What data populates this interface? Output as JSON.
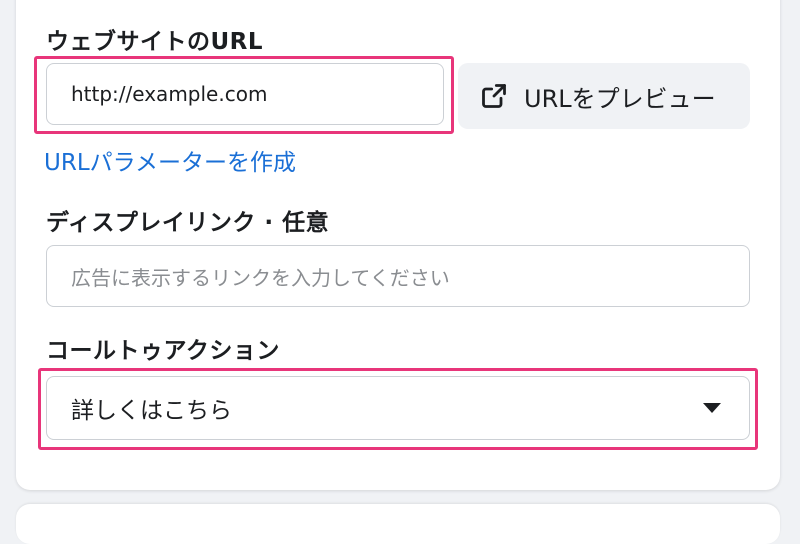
{
  "website_url": {
    "label": "ウェブサイトのURL",
    "value": "http://example.com",
    "preview_button": "URLをプレビュー",
    "preview_icon": "external-link-icon",
    "params_link": "URLパラメーターを作成"
  },
  "display_link": {
    "label": "ディスプレイリンク · 任意",
    "placeholder": "広告に表示するリンクを入力してください"
  },
  "call_to_action": {
    "label": "コールトゥアクション",
    "selected": "詳しくはこちら",
    "caret_icon": "caret-down-icon"
  },
  "colors": {
    "highlight": "#e8357a",
    "link": "#1a6fd6"
  }
}
